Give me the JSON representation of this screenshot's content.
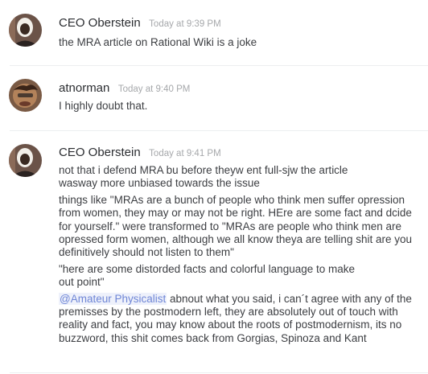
{
  "messages": [
    {
      "username": "CEO Oberstein",
      "timestamp": "Today at 9:39 PM",
      "avatar_icon": "user-avatar-icon",
      "paragraphs": [
        "the MRA article on Rational Wiki is a joke"
      ]
    },
    {
      "username": "atnorman",
      "timestamp": "Today at 9:40 PM",
      "avatar_icon": "user-avatar-icon",
      "paragraphs": [
        "I highly doubt that."
      ]
    },
    {
      "username": "CEO Oberstein",
      "timestamp": "Today at 9:41 PM",
      "avatar_icon": "user-avatar-icon",
      "paragraphs": [
        "not that i defend MRA bu before  theyw ent full-sjw the article wasway more unbiased towards the issue",
        "things like \"MRAs are a bunch of people who think men suffer opression from women, they may or may not be right. HEre are some fact and dcide for yourself.\" were transformed to \"MRAs are people who think men are opressed form women, although we all know theya are telling shit are you definitively should not listen to them\"",
        "\"here are some distorded facts and colorful language to make out point\""
      ],
      "mention": {
        "name": "@Amateur Physicalist",
        "text": " abnout what you said, i can´t agree with any of the premisses by the postmodern left, they are  absolutely out of touch with reality and fact, you may know about the roots of postmodernism, its no buzzword, this shit comes back from Gorgias, Spinoza and Kant"
      }
    }
  ],
  "colors": {
    "mention": "#6f86d6",
    "timestamp": "#a6a8ab",
    "divider": "#eceef0"
  }
}
